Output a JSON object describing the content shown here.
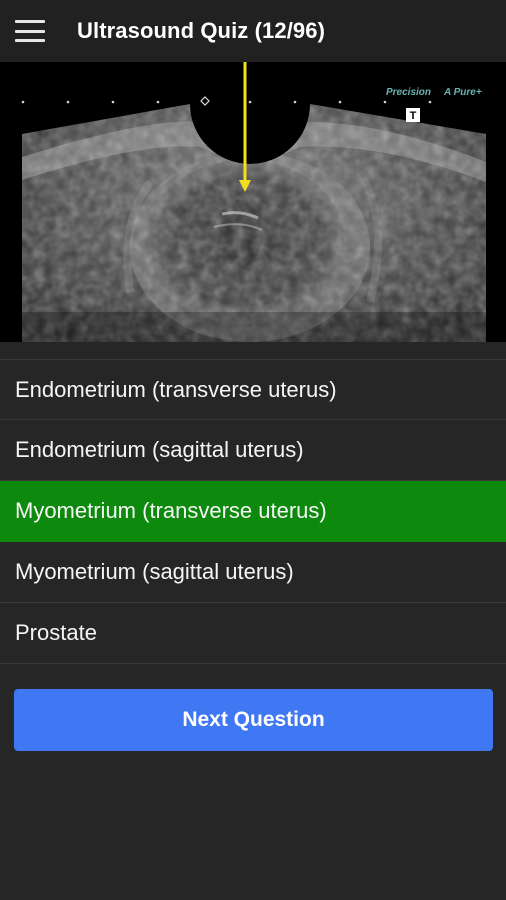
{
  "app": {
    "title": "Ultrasound Quiz (12/96)"
  },
  "image": {
    "brand_left": "Precision",
    "brand_right": "A Pure+",
    "marker": "T",
    "arrow_color": "#f2e01f"
  },
  "answers": [
    {
      "label": "Endometrium (transverse uterus)",
      "state": "default"
    },
    {
      "label": "Endometrium (sagittal uterus)",
      "state": "default"
    },
    {
      "label": "Myometrium (transverse uterus)",
      "state": "correct"
    },
    {
      "label": "Myometrium (sagittal uterus)",
      "state": "default"
    },
    {
      "label": "Prostate",
      "state": "default"
    }
  ],
  "next_button": {
    "label": "Next Question"
  },
  "colors": {
    "background": "#262626",
    "app_bar": "#212121",
    "correct_answer": "#0d8a0d",
    "primary_button": "#3f78f2"
  }
}
